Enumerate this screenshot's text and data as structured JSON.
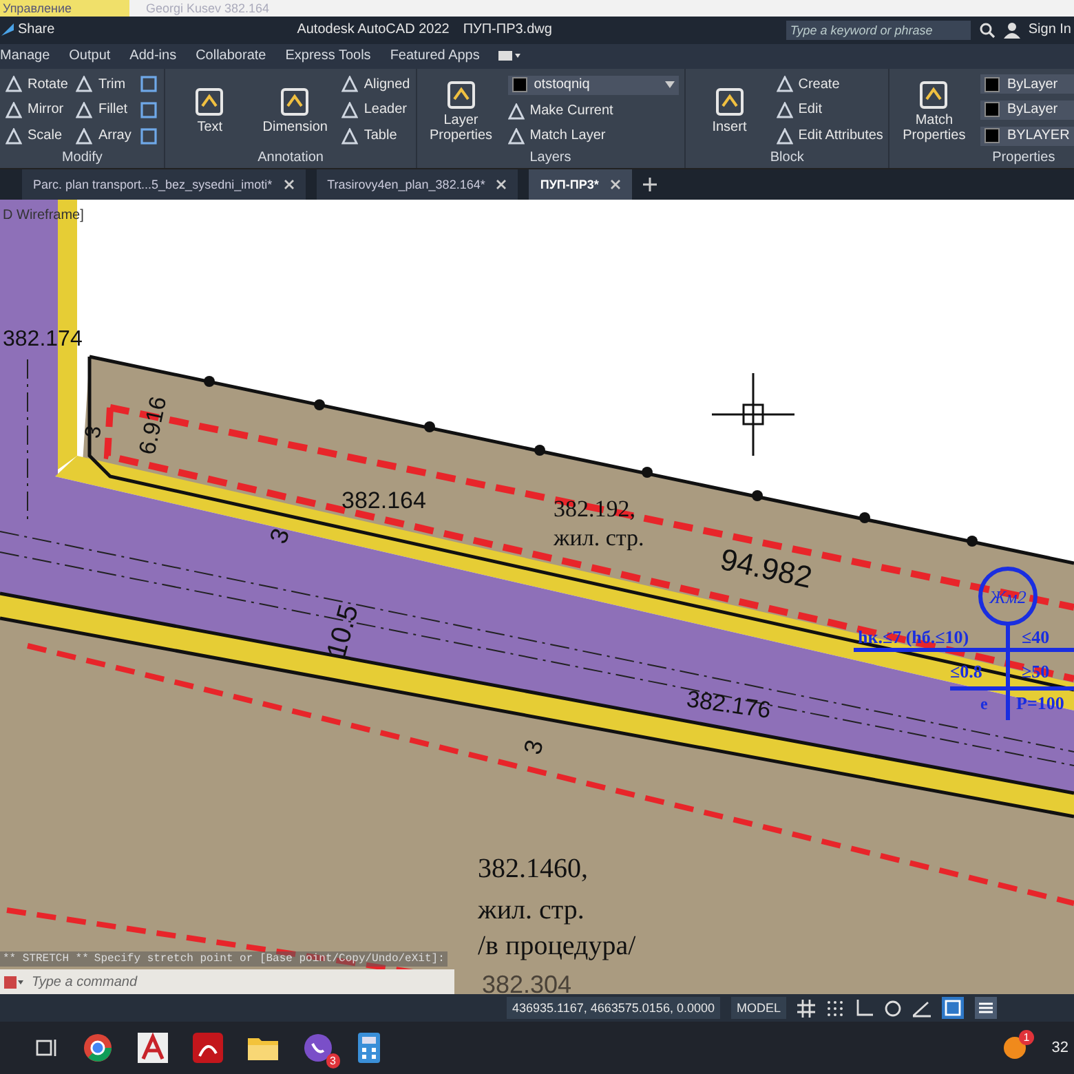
{
  "top_strip": {
    "label": "Управление",
    "user": "Georgi Kusev 382.164"
  },
  "title_bar": {
    "share": "Share",
    "title": "Autodesk AutoCAD 2022",
    "file": "ПУП-ПР3.dwg",
    "search": {
      "placeholder": "Type a keyword or phrase"
    },
    "sign_in": "Sign In"
  },
  "ribbon_tabs": [
    "Manage",
    "Output",
    "Add-ins",
    "Collaborate",
    "Express Tools",
    "Featured Apps"
  ],
  "ribbon_panels": [
    {
      "title": "Modify",
      "columns": [
        [
          {
            "kind": "small",
            "label": "Rotate"
          },
          {
            "kind": "small",
            "label": "Mirror"
          },
          {
            "kind": "small",
            "label": "Scale"
          }
        ],
        [
          {
            "kind": "small",
            "label": "Trim"
          },
          {
            "kind": "small",
            "label": "Fillet"
          },
          {
            "kind": "small",
            "label": "Array"
          }
        ],
        [
          {
            "kind": "icon"
          },
          {
            "kind": "icon"
          },
          {
            "kind": "icon"
          }
        ]
      ]
    },
    {
      "title": "Annotation",
      "columns": [
        [
          {
            "kind": "large",
            "label": "Text"
          }
        ],
        [
          {
            "kind": "large",
            "label": "Dimension"
          }
        ],
        [
          {
            "kind": "small",
            "label": "Aligned"
          },
          {
            "kind": "small",
            "label": "Leader"
          },
          {
            "kind": "small",
            "label": "Table"
          }
        ]
      ]
    },
    {
      "title": "Layers",
      "columns": [
        [
          {
            "kind": "large",
            "label": "Layer Properties"
          }
        ],
        [
          {
            "kind": "dropdown",
            "label": "otstoqniq"
          },
          {
            "kind": "small",
            "label": "Make Current"
          },
          {
            "kind": "small",
            "label": "Match Layer"
          }
        ]
      ]
    },
    {
      "title": "Block",
      "columns": [
        [
          {
            "kind": "large",
            "label": "Insert"
          }
        ],
        [
          {
            "kind": "small",
            "label": "Create"
          },
          {
            "kind": "small",
            "label": "Edit"
          },
          {
            "kind": "small",
            "label": "Edit Attributes"
          }
        ]
      ]
    },
    {
      "title": "Properties",
      "columns": [
        [
          {
            "kind": "large",
            "label": "Match Properties"
          }
        ],
        [
          {
            "kind": "dropdown",
            "label": "ByLayer"
          },
          {
            "kind": "dropdown",
            "label": "ByLayer"
          },
          {
            "kind": "dropdown",
            "label": "BYLAYER"
          }
        ]
      ]
    }
  ],
  "doc_tabs": [
    {
      "label": "Parc. plan transport...5_bez_sysedni_imoti*",
      "selected": false
    },
    {
      "label": "Trasirovy4en_plan_382.164*",
      "selected": false
    },
    {
      "label": "ПУП-ПР3*",
      "selected": true
    }
  ],
  "canvas": {
    "viewport_label": "D Wireframe]",
    "labels": [
      "382.174",
      "6.916",
      "3",
      "382.164",
      "382.192,",
      "жил. стр.",
      "94.982",
      "3",
      "10.5",
      "3",
      "382.176",
      "382.1460,",
      "жил. стр.",
      "/в процедура/",
      "382.304"
    ],
    "zone_sign": {
      "code": "Жм2",
      "cells": [
        "hк.≤7 (hб.≤10)",
        "≤40",
        "≤0.8",
        "≥50",
        "e",
        "P=100"
      ]
    }
  },
  "command_line": {
    "history": [
      "** STRETCH **",
      "Specify stretch point or [Base point/Copy/Undo/eXit]:"
    ],
    "placeholder": "Type a command"
  },
  "status_bar": {
    "coordinates": "436935.1167, 4663575.0156, 0.0000",
    "space": "MODEL"
  },
  "taskbar": {
    "badges": [
      "3",
      "1"
    ],
    "clock": "32"
  }
}
